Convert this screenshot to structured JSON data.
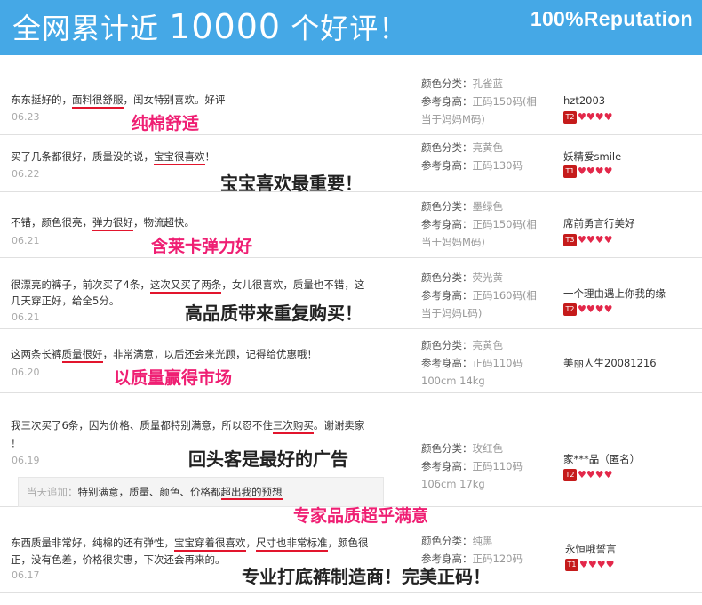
{
  "banner": {
    "title_prefix": "全网累计近",
    "title_number": "10000",
    "title_suffix": "个好评！",
    "right_text": "100%Reputation"
  },
  "labels": {
    "color": "颜色分类：",
    "height": "参考身高："
  },
  "reviews": [
    {
      "comment_parts": [
        "东东挺好的，",
        "面料很舒服",
        "，闺女特别喜欢。好评"
      ],
      "date": "06.23",
      "slogan": "纯棉舒适",
      "color": "孔雀蓝",
      "height": "正码150码(相当于妈妈M码)",
      "user": "hzt2003",
      "level": "T2",
      "hearts": "♥♥♥♥"
    },
    {
      "comment_parts": [
        "买了几条都很好，质量没的说，",
        "宝宝很喜欢",
        "！"
      ],
      "date": "06.22",
      "slogan": "宝宝喜欢最重要！",
      "color": "亮黄色",
      "height": "正码130码",
      "user": "妖精爱smile",
      "level": "T1",
      "hearts": "♥♥♥♥"
    },
    {
      "comment_parts": [
        "不错，颜色很亮，",
        "弹力很好",
        "，物流超快。"
      ],
      "date": "06.21",
      "slogan": "含莱卡弹力好",
      "color": "墨绿色",
      "height": "正码150码(相当于妈妈M码)",
      "user": "席前勇言行美好",
      "level": "T3",
      "hearts": "♥♥♥♥"
    },
    {
      "comment_parts": [
        "很漂亮的裤子，前次买了4条，",
        "这次又买了两条",
        "，女儿很喜欢，质量也不错，这"
      ],
      "comment_line2": "几天穿正好，给全5分。",
      "date": "06.21",
      "slogan": "高品质带来重复购买！",
      "color": "荧光黄",
      "height": "正码160码(相当于妈妈L码)",
      "user": "一个理由遇上你我的缘",
      "level": "T2",
      "hearts": "♥♥♥♥"
    },
    {
      "comment_parts": [
        "这两条长裤",
        "质量很好",
        "，非常满意，以后还会来光顾，记得给优惠哦！"
      ],
      "date": "06.20",
      "slogan": "以质量赢得市场",
      "color": "亮黄色",
      "height": "正码110码",
      "extra": "100cm 14kg",
      "user": "美丽人生20081216"
    },
    {
      "comment_parts": [
        "我三次买了6条，因为价格、质量都特别满意，所以忍不住",
        "三次购买",
        "。谢谢卖家"
      ],
      "comment_line2": "！",
      "date": "06.19",
      "slogan": "回头客是最好的广告",
      "append_label": "当天追加：",
      "append_parts": [
        "特别满意，质量、颜色、价格都",
        "超出我的预想"
      ],
      "slogan2": "专家品质超乎满意",
      "color": "玫红色",
      "height": "正码110码",
      "extra": "106cm 17kg",
      "user": "家***品（匿名）",
      "level": "T2",
      "hearts": "♥♥♥♥"
    },
    {
      "comment_parts": [
        "东西质量非常好，纯棉的还有弹性，",
        "宝宝穿着很喜欢",
        "，",
        "尺寸也非常标准",
        "，颜色很"
      ],
      "comment_line2": "正，没有色差，价格很实惠，下次还会再来的。",
      "date": "06.17",
      "slogan": "专业打底裤制造商！完美正码！",
      "color": "纯黑",
      "height": "正码120码",
      "user": "永恒哦誓言",
      "level": "T1",
      "hearts": "♥♥♥♥"
    }
  ]
}
